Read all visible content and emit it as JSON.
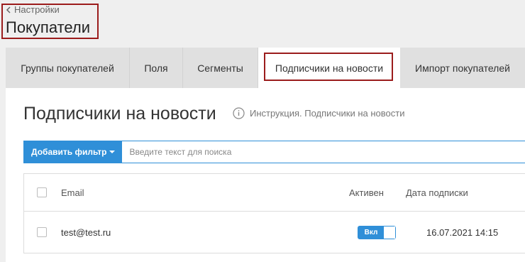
{
  "header": {
    "back_label": "Настройки",
    "title": "Покупатели"
  },
  "tabs": [
    {
      "label": "Группы покупателей",
      "active": false
    },
    {
      "label": "Поля",
      "active": false
    },
    {
      "label": "Сегменты",
      "active": false
    },
    {
      "label": "Подписчики на новости",
      "active": true
    },
    {
      "label": "Импорт покупателей",
      "active": false
    }
  ],
  "main": {
    "section_title": "Подписчики на новости",
    "instruction_link": "Инструкция. Подписчики на новости",
    "filter_button": "Добавить фильтр",
    "search_placeholder": "Введите текст для поиска"
  },
  "table": {
    "columns": {
      "email": "Email",
      "active": "Активен",
      "date": "Дата подписки"
    },
    "rows": [
      {
        "email": "test@test.ru",
        "active": "Вкл",
        "date": "16.07.2021 14:15"
      }
    ]
  },
  "colors": {
    "accent": "#2f8fd8",
    "highlight_border": "#9b1c1c",
    "background": "#efefef"
  }
}
